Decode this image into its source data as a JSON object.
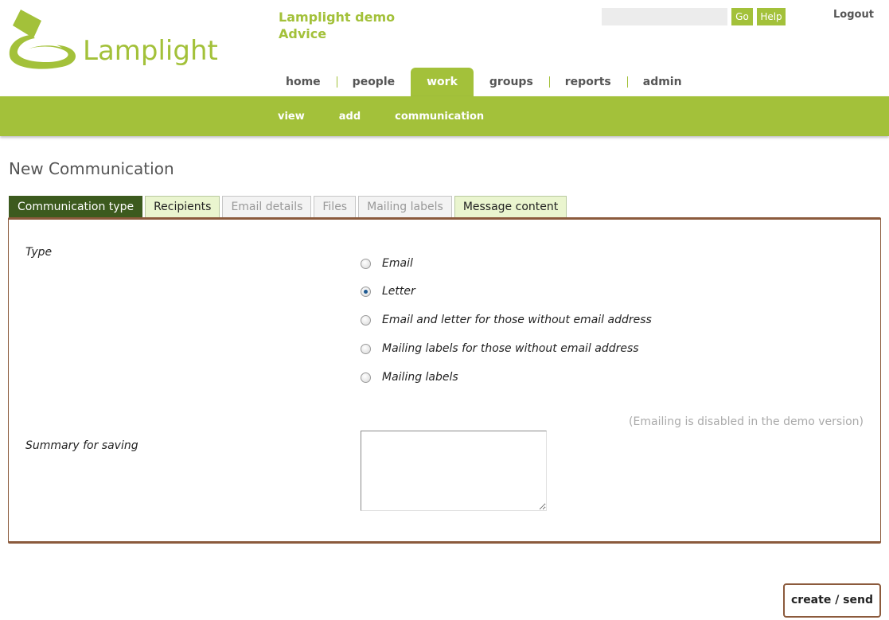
{
  "header": {
    "logo_text": "Lamplight",
    "org_name_line1": "Lamplight demo",
    "org_name_line2": "Advice",
    "search_value": "",
    "go_label": "Go",
    "help_label": "Help",
    "logout_label": "Logout"
  },
  "main_nav": [
    {
      "label": "home"
    },
    {
      "label": "people"
    },
    {
      "label": "work"
    },
    {
      "label": "groups"
    },
    {
      "label": "reports"
    },
    {
      "label": "admin"
    }
  ],
  "sub_nav": [
    {
      "label": "view"
    },
    {
      "label": "add"
    },
    {
      "label": "communication"
    }
  ],
  "page": {
    "title": "New Communication"
  },
  "tabs": [
    {
      "label": "Communication type",
      "state": "active"
    },
    {
      "label": "Recipients",
      "state": "enabled"
    },
    {
      "label": "Email details",
      "state": "disabled"
    },
    {
      "label": "Files",
      "state": "disabled"
    },
    {
      "label": "Mailing labels",
      "state": "disabled"
    },
    {
      "label": "Message content",
      "state": "enabled"
    }
  ],
  "form": {
    "type_label": "Type",
    "options": [
      {
        "label": "Email",
        "checked": false
      },
      {
        "label": "Letter",
        "checked": true
      },
      {
        "label": "Email and letter for those without email address",
        "checked": false
      },
      {
        "label": "Mailing labels for those without email address",
        "checked": false
      },
      {
        "label": "Mailing labels",
        "checked": false
      }
    ],
    "disabled_note": "(Emailing is disabled in the demo version)",
    "summary_label": "Summary for saving",
    "summary_value": ""
  },
  "actions": {
    "create_send_label": "create / send"
  },
  "colors": {
    "brand_green": "#a3c13a",
    "active_tab": "#3c5a1e",
    "panel_border": "#8b5a3c"
  }
}
